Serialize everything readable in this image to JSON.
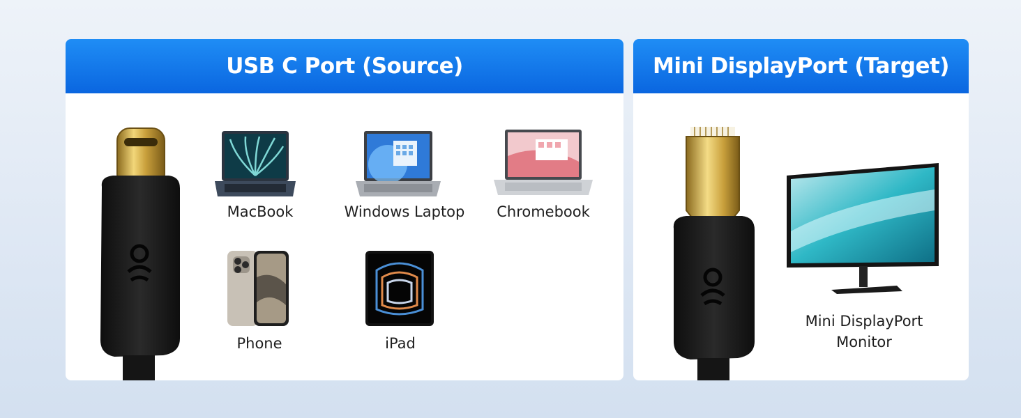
{
  "source_panel": {
    "title": "USB C Port (Source)",
    "devices": [
      {
        "label": "MacBook",
        "icon": "macbook-icon"
      },
      {
        "label": "Windows Laptop",
        "icon": "windows-laptop-icon"
      },
      {
        "label": "Chromebook",
        "icon": "chromebook-icon"
      },
      {
        "label": "Phone",
        "icon": "phone-icon"
      },
      {
        "label": "iPad",
        "icon": "ipad-icon"
      }
    ],
    "connector_icon": "usb-c-connector-icon"
  },
  "target_panel": {
    "title": "Mini DisplayPort (Target)",
    "device_label_line1": "Mini DisplayPort",
    "device_label_line2": "Monitor",
    "connector_icon": "mini-displayport-connector-icon",
    "device_icon": "monitor-icon"
  },
  "colors": {
    "header_blue": "#0a66e0",
    "connector_gold": "#d9b24c",
    "cable_black": "#1c1c1c"
  }
}
